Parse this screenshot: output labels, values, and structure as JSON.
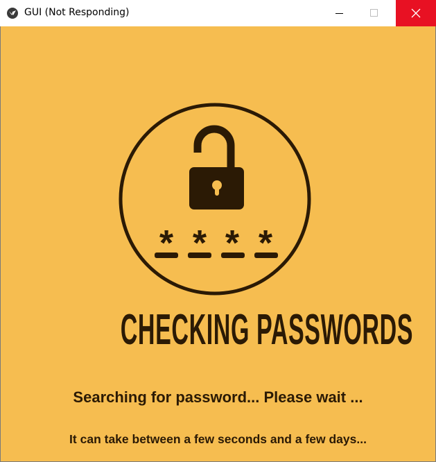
{
  "window": {
    "title": "GUI (Not Responding)"
  },
  "main": {
    "headline": "CHECKING PASSWORDS",
    "status": "Searching for password... Please wait ...",
    "note": "It can take between a few seconds and a few days...",
    "masked_chars": [
      "*",
      "*",
      "*",
      "*"
    ]
  },
  "colors": {
    "background": "#f6bd50",
    "ink": "#2b1a05",
    "close": "#e81123"
  }
}
